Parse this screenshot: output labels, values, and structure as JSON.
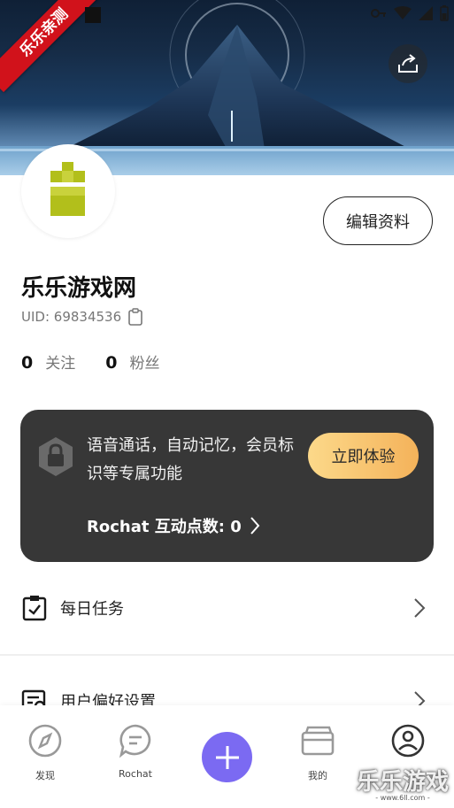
{
  "banner": {
    "ribbon_text": "乐乐亲测"
  },
  "profile": {
    "edit_label": "编辑资料",
    "username": "乐乐游戏网",
    "uid_text": "UID: 69834536",
    "following_count": "0",
    "following_label": "关注",
    "followers_count": "0",
    "followers_label": "粉丝"
  },
  "premium": {
    "description": "语音通话，自动记忆，会员标识等专属功能",
    "try_label": "立即体验",
    "points_label": "Rochat 互动点数: 0"
  },
  "menu": {
    "items": [
      {
        "label": "每日任务",
        "icon": "clipboard-check-icon"
      },
      {
        "label": "用户偏好设置",
        "icon": "settings-doc-icon"
      }
    ]
  },
  "nav": {
    "items": [
      {
        "label": "发现",
        "icon": "compass-icon"
      },
      {
        "label": "Rochat",
        "icon": "chat-bubble-icon"
      },
      {
        "label": "",
        "icon": "plus-icon"
      },
      {
        "label": "我的",
        "icon": "wallet-icon"
      },
      {
        "label": "",
        "icon": "profile-icon"
      }
    ]
  },
  "watermark": {
    "text": "乐乐游戏",
    "url": "- www.6ll.com -"
  },
  "colors": {
    "accent": "#7b6af2",
    "premium_bg": "#373737",
    "gold_start": "#fcd98a",
    "gold_end": "#f4b25a"
  }
}
